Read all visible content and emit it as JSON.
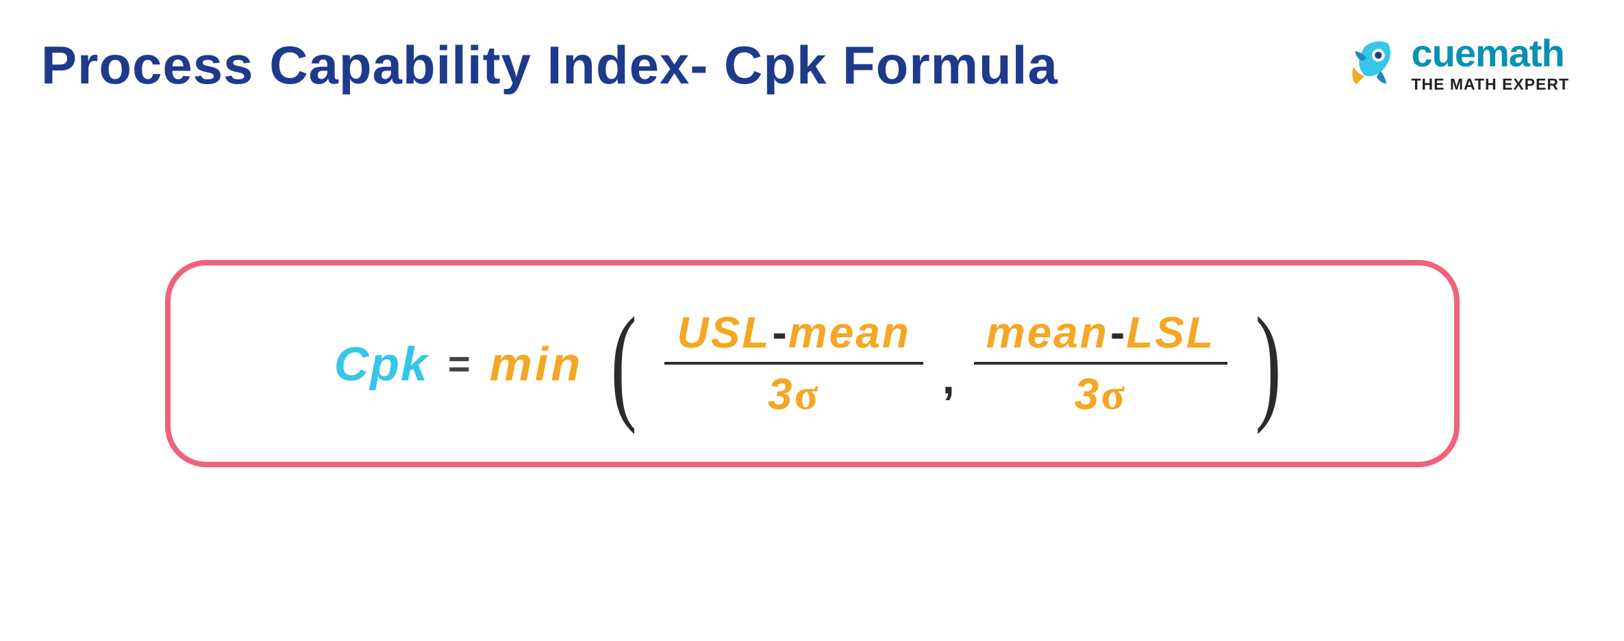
{
  "header": {
    "title": "Process Capability Index- Cpk Formula"
  },
  "logo": {
    "brand": "cuemath",
    "tagline": "THE MATH EXPERT"
  },
  "formula": {
    "lhs": "Cpk",
    "eq": "=",
    "func": "min",
    "paren_open": "(",
    "paren_close": ")",
    "comma": ",",
    "frac1": {
      "num_a": "USL",
      "op": "-",
      "num_b": "mean",
      "den_coeff": "3",
      "den_sym": "σ"
    },
    "frac2": {
      "num_a": "mean",
      "op": "-",
      "num_b": "LSL",
      "den_coeff": "3",
      "den_sym": "σ"
    }
  }
}
